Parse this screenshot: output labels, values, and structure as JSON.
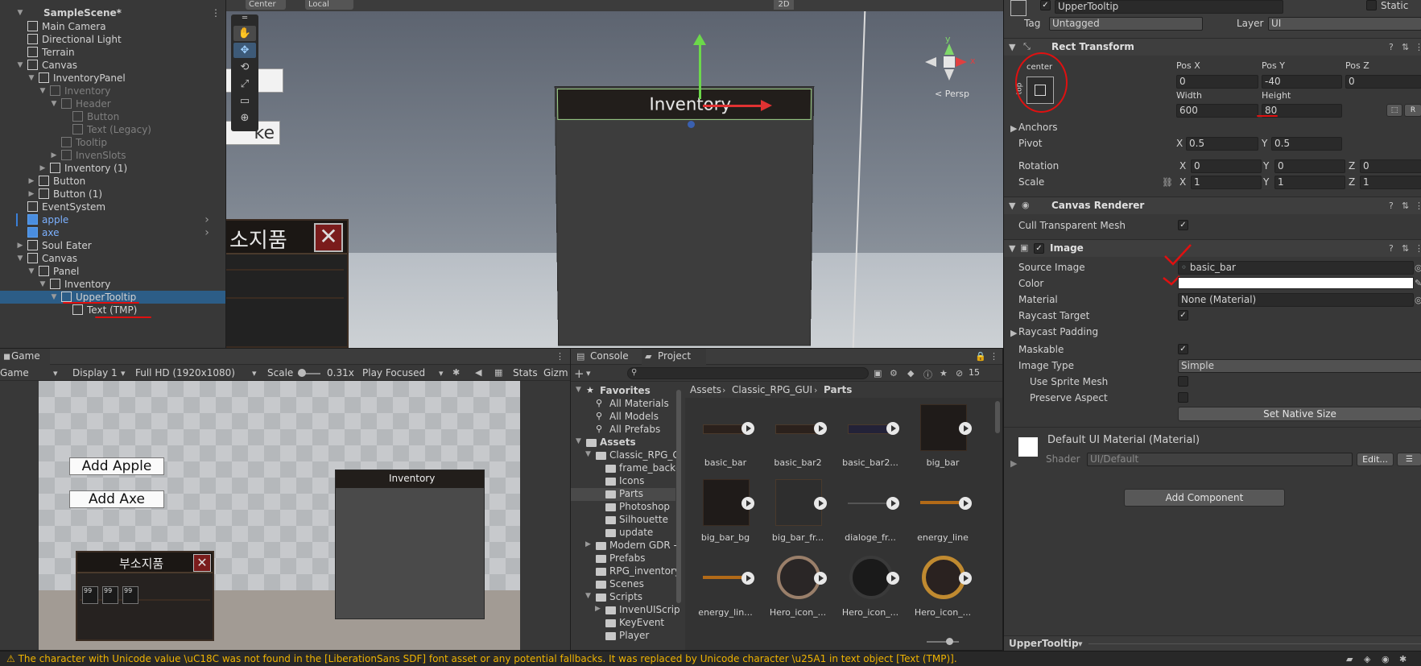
{
  "hierarchy": {
    "scene_name": "SampleScene*",
    "items": [
      {
        "label": "Main Camera"
      },
      {
        "label": "Directional Light"
      },
      {
        "label": "Terrain"
      },
      {
        "label": "Canvas"
      },
      {
        "label": "InventoryPanel"
      },
      {
        "label": "Inventory"
      },
      {
        "label": "Header"
      },
      {
        "label": "Button"
      },
      {
        "label": "Text (Legacy)"
      },
      {
        "label": "Tooltip"
      },
      {
        "label": "InvenSlots"
      },
      {
        "label": "Inventory (1)"
      },
      {
        "label": "Button"
      },
      {
        "label": "Button (1)"
      },
      {
        "label": "EventSystem"
      },
      {
        "label": "apple"
      },
      {
        "label": "axe"
      },
      {
        "label": "Soul Eater"
      },
      {
        "label": "Canvas"
      },
      {
        "label": "Panel"
      },
      {
        "label": "Inventory"
      },
      {
        "label": "UpperTooltip"
      },
      {
        "label": "Text (TMP)"
      }
    ]
  },
  "scene_view": {
    "toolbar": {
      "pivot": "Center",
      "space": "Local",
      "mode_2d": "2D"
    },
    "persp_label": "< Persp",
    "inventory_header": "Inventory",
    "korean_panel_title": "소지품",
    "partial_button_text": "ke",
    "gizmo_axes": {
      "y": "y",
      "x": "x"
    }
  },
  "inspector": {
    "object_name": "UpperTooltip",
    "static_label": "Static",
    "tag_label": "Tag",
    "tag_value": "Untagged",
    "layer_label": "Layer",
    "layer_value": "UI",
    "rect_transform": {
      "title": "Rect Transform",
      "anchor_preset_h": "center",
      "anchor_preset_v": "top",
      "pos_x_label": "Pos X",
      "pos_x": "0",
      "pos_y_label": "Pos Y",
      "pos_y": "-40",
      "pos_z_label": "Pos Z",
      "pos_z": "0",
      "width_label": "Width",
      "width": "600",
      "height_label": "Height",
      "height": "80",
      "anchors_label": "Anchors",
      "pivot_label": "Pivot",
      "pivot_x": "0.5",
      "pivot_y": "0.5",
      "rotation_label": "Rotation",
      "rot_x": "0",
      "rot_y": "0",
      "rot_z": "0",
      "scale_label": "Scale",
      "scale_x": "1",
      "scale_y": "1",
      "scale_z": "1",
      "x": "X",
      "y": "Y",
      "z": "Z"
    },
    "canvas_renderer": {
      "title": "Canvas Renderer",
      "cull_label": "Cull Transparent Mesh"
    },
    "image": {
      "title": "Image",
      "source_image_label": "Source Image",
      "source_image": "basic_bar",
      "color_label": "Color",
      "material_label": "Material",
      "material": "None (Material)",
      "raycast_target_label": "Raycast Target",
      "raycast_padding_label": "Raycast Padding",
      "maskable_label": "Maskable",
      "image_type_label": "Image Type",
      "image_type": "Simple",
      "use_sprite_mesh_label": "Use Sprite Mesh",
      "preserve_aspect_label": "Preserve Aspect",
      "set_native_size": "Set Native Size"
    },
    "material_block": {
      "name": "Default UI Material (Material)",
      "shader_label": "Shader",
      "shader": "UI/Default",
      "edit": "Edit..."
    },
    "add_component": "Add Component",
    "footer_object": "UpperTooltip"
  },
  "game": {
    "tab": "Game",
    "display_mode": "Game",
    "display": "Display 1",
    "resolution": "Full HD (1920x1080)",
    "scale_label": "Scale",
    "scale_value": "0.31x",
    "play_focused": "Play Focused",
    "stats": "Stats",
    "gizmos": "Gizm",
    "add_apple": "Add Apple",
    "add_axe": "Add Axe",
    "inventory_title": "Inventory",
    "korean_title": "부소지품",
    "slot_counts": [
      "99",
      "99",
      "99"
    ]
  },
  "project": {
    "tab_console": "Console",
    "tab_project": "Project",
    "hidden_count": "15",
    "breadcrumb": [
      "Assets",
      "Classic_RPG_GUI",
      "Parts"
    ],
    "tree": [
      {
        "label": "Favorites",
        "bold": true
      },
      {
        "label": "All Materials"
      },
      {
        "label": "All Models"
      },
      {
        "label": "All Prefabs"
      },
      {
        "label": "Assets",
        "bold": true
      },
      {
        "label": "Classic_RPG_G"
      },
      {
        "label": "frame_backg"
      },
      {
        "label": "Icons"
      },
      {
        "label": "Parts"
      },
      {
        "label": "Photoshop"
      },
      {
        "label": "Silhouette"
      },
      {
        "label": "update"
      },
      {
        "label": "Modern GDR -"
      },
      {
        "label": "Prefabs"
      },
      {
        "label": "RPG_inventory"
      },
      {
        "label": "Scenes"
      },
      {
        "label": "Scripts"
      },
      {
        "label": "InvenUIScrip"
      },
      {
        "label": "KeyEvent"
      },
      {
        "label": "Player"
      }
    ],
    "assets": [
      {
        "label": "basic_bar"
      },
      {
        "label": "basic_bar2"
      },
      {
        "label": "basic_bar2..."
      },
      {
        "label": "big_bar"
      },
      {
        "label": "big_bar_bg"
      },
      {
        "label": "big_bar_fr..."
      },
      {
        "label": "dialoge_fr..."
      },
      {
        "label": "energy_line"
      },
      {
        "label": "energy_lin..."
      },
      {
        "label": "Hero_icon_..."
      },
      {
        "label": "Hero_icon_..."
      },
      {
        "label": "Hero_icon_..."
      }
    ]
  },
  "status_message": "The character with Unicode value \\uC18C was not found in the [LiberationSans SDF] font asset or any potential fallbacks. It was replaced by Unicode character \\u25A1 in text object [Text (TMP)]."
}
